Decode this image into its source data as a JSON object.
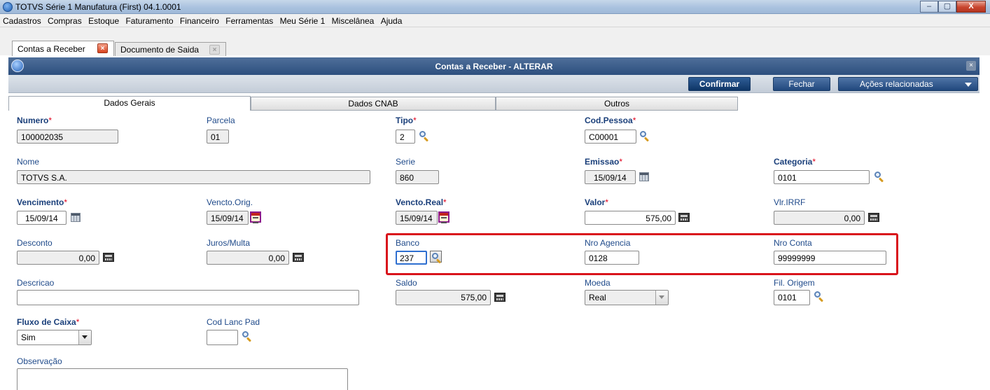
{
  "window": {
    "title": "TOTVS Série 1 Manufatura (First) 04.1.0001",
    "min": "–",
    "max": "▢",
    "close": "X"
  },
  "menu": [
    "Cadastros",
    "Compras",
    "Estoque",
    "Faturamento",
    "Financeiro",
    "Ferramentas",
    "Meu Série 1",
    "Miscelânea",
    "Ajuda"
  ],
  "doc_tabs": [
    {
      "label": "Contas a Receber",
      "close": "×"
    },
    {
      "label": "Documento de Saida",
      "close": "×"
    }
  ],
  "dialog": {
    "title": "Contas a Receber - ALTERAR",
    "close": "×"
  },
  "toolbar": {
    "confirm": "Confirmar",
    "close": "Fechar",
    "actions": "Ações relacionadas"
  },
  "form_tabs": [
    "Dados Gerais",
    "Dados CNAB",
    "Outros"
  ],
  "fields": {
    "numero": {
      "label": "Numero",
      "value": "100002035"
    },
    "parcela": {
      "label": "Parcela",
      "value": "01"
    },
    "tipo": {
      "label": "Tipo",
      "value": "2"
    },
    "cod_pessoa": {
      "label": "Cod.Pessoa",
      "value": "C00001"
    },
    "nome": {
      "label": "Nome",
      "value": "TOTVS S.A."
    },
    "serie": {
      "label": "Serie",
      "value": "860"
    },
    "emissao": {
      "label": "Emissao",
      "value": "15/09/14"
    },
    "categoria": {
      "label": "Categoria",
      "value": "0101"
    },
    "vencimento": {
      "label": "Vencimento",
      "value": "15/09/14"
    },
    "vencto_orig": {
      "label": "Vencto.Orig.",
      "value": "15/09/14"
    },
    "vencto_real": {
      "label": "Vencto.Real",
      "value": "15/09/14"
    },
    "valor": {
      "label": "Valor",
      "value": "575,00"
    },
    "vlr_irrf": {
      "label": "Vlr.IRRF",
      "value": "0,00"
    },
    "desconto": {
      "label": "Desconto",
      "value": "0,00"
    },
    "juros_multa": {
      "label": "Juros/Multa",
      "value": "0,00"
    },
    "banco": {
      "label": "Banco",
      "value": "237"
    },
    "nro_agencia": {
      "label": "Nro Agencia",
      "value": "0128"
    },
    "nro_conta": {
      "label": "Nro Conta",
      "value": "99999999"
    },
    "descricao": {
      "label": "Descricao",
      "value": ""
    },
    "saldo": {
      "label": "Saldo",
      "value": "575,00"
    },
    "moeda": {
      "label": "Moeda",
      "value": "Real"
    },
    "fil_origem": {
      "label": "Fil. Origem",
      "value": "0101"
    },
    "fluxo_caixa": {
      "label": "Fluxo de Caixa",
      "value": "Sim"
    },
    "cod_lanc_pad": {
      "label": "Cod Lanc Pad",
      "value": ""
    },
    "observacao": {
      "label": "Observação",
      "value": ""
    }
  },
  "required_marker": "*",
  "colors": {
    "label": "#1f4a8a",
    "required": "#e0001b",
    "highlight": "#d9141c",
    "header": "#2d4f7e"
  }
}
